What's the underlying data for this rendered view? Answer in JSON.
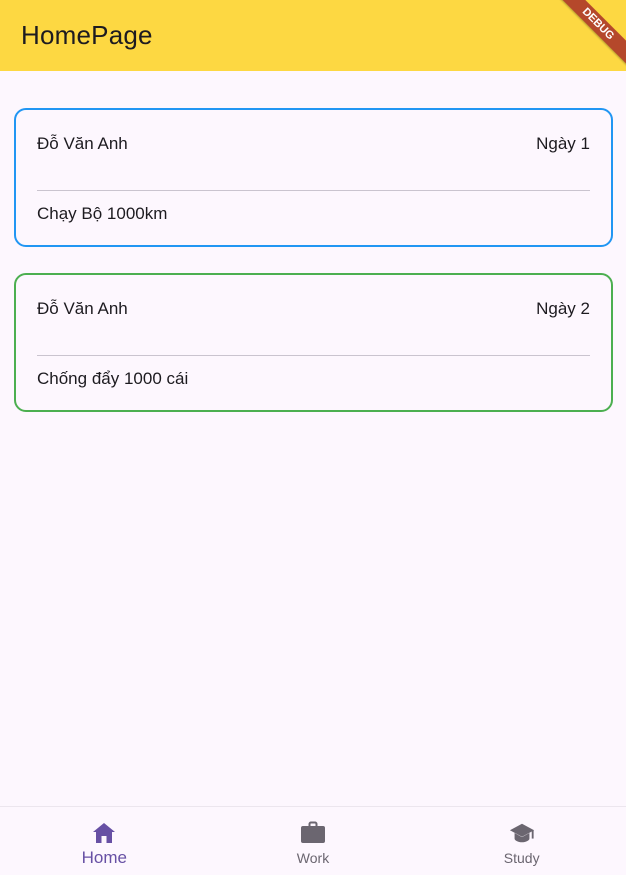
{
  "appbar": {
    "title": "HomePage",
    "debug_label": "DEBUG"
  },
  "cards": [
    {
      "name": "Đỗ Văn Anh",
      "day": "Ngày 1",
      "task": "Chạy Bộ 1000km",
      "border_color": "#2196f3"
    },
    {
      "name": "Đỗ Văn Anh",
      "day": "Ngày 2",
      "task": "Chống đẩy 1000 cái",
      "border_color": "#4caf50"
    }
  ],
  "bottom_nav": {
    "items": [
      {
        "label": "Home",
        "icon": "home-icon",
        "active": true
      },
      {
        "label": "Work",
        "icon": "briefcase-icon",
        "active": false
      },
      {
        "label": "Study",
        "icon": "graduation-cap-icon",
        "active": false
      }
    ]
  },
  "colors": {
    "appbar": "#fdd842",
    "accent": "#6750a4",
    "background": "#fdf7fe"
  }
}
